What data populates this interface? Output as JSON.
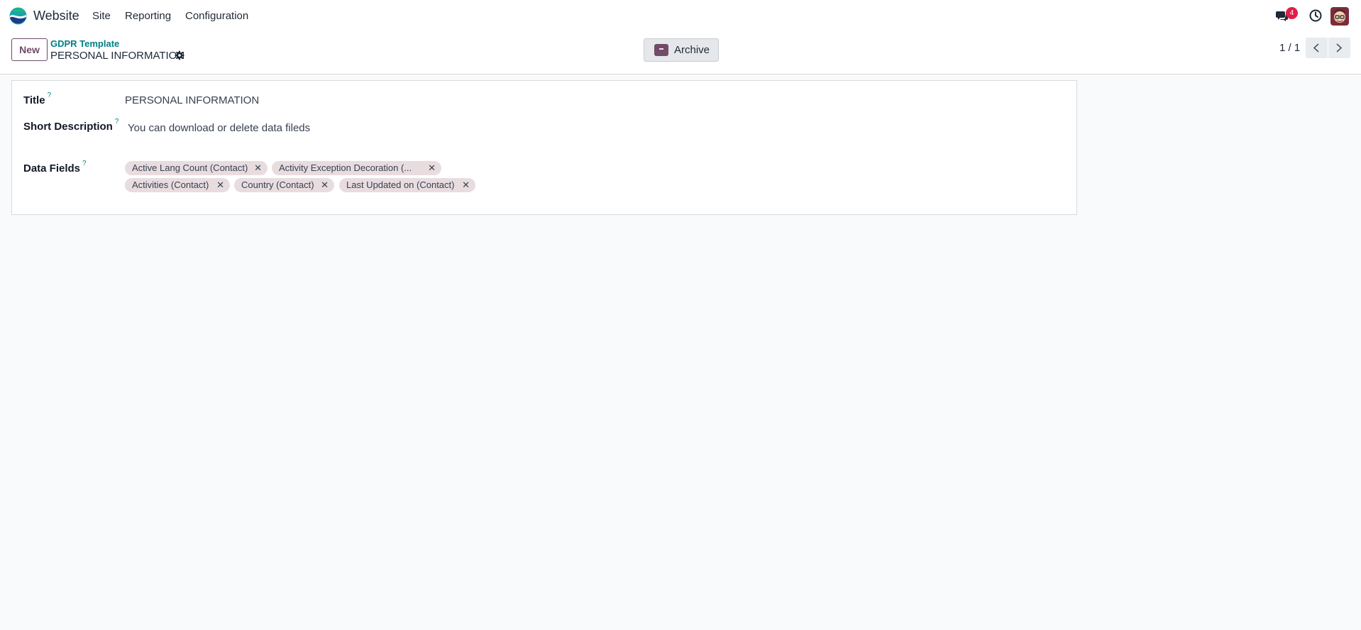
{
  "navbar": {
    "app_name": "Website",
    "menu": [
      "Site",
      "Reporting",
      "Configuration"
    ],
    "messages_badge": "4",
    "icons": {
      "logo": "website-app-logo",
      "messages": "chat-bubbles-icon",
      "activities": "clock-icon",
      "user": "user-avatar"
    }
  },
  "control_panel": {
    "new_label": "New",
    "breadcrumb": "GDPR Template",
    "record_title": "PERSONAL INFORMATION",
    "archive_label": "Archive",
    "pager": "1 / 1"
  },
  "form": {
    "title_label": "Title",
    "title_help": "?",
    "title_value": "PERSONAL INFORMATION",
    "short_desc_label": "Short Description",
    "short_desc_help": "?",
    "short_desc_value": "You can download or delete data fileds",
    "data_fields_label": "Data Fields",
    "data_fields_help": "?",
    "data_fields": [
      "Active Lang Count (Contact)",
      "Activity Exception Decoration (...",
      "Activities (Contact)",
      "Country (Contact)",
      "Last Updated on (Contact)"
    ]
  },
  "colors": {
    "brand": "#714b67",
    "link": "#017e84",
    "badge": "#e11d48",
    "tag_bg": "#e8dcdf",
    "page_bg": "#f9fafb"
  }
}
